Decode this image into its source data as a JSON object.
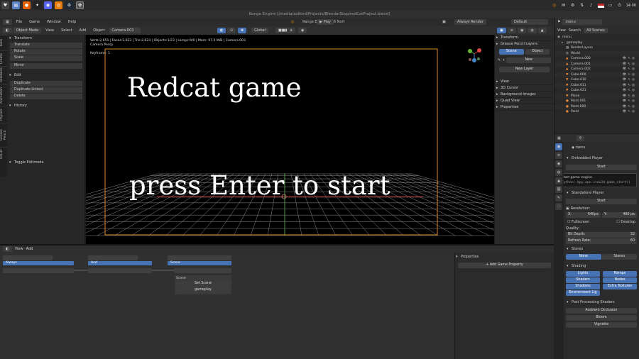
{
  "window": {
    "title": "Range Engine [/media/solford/Projects/BlenderStop/redCatProject.blend]",
    "version": "Range Engine v1.6 Nort"
  },
  "taskbar": {
    "time": "14:00",
    "apps": [
      "heart-icon",
      "file-manager-icon",
      "firefox-icon",
      "inkscape-icon",
      "discord-icon",
      "blender-icon",
      "steam-icon",
      "range-engine-icon"
    ]
  },
  "menu": {
    "items": [
      "File",
      "Game",
      "Window",
      "Help"
    ],
    "workspace": "Default",
    "scene": "menu",
    "play_label": "Play",
    "renderer": "Always Render"
  },
  "viewport_header": {
    "mode": "Object Mode",
    "items": [
      "View",
      "Select",
      "Add",
      "Object"
    ],
    "camera": "Camera.003",
    "pivot": "Global"
  },
  "toolshelf": {
    "tabs": [
      "Tools",
      "Create",
      "Relations",
      "Animation",
      "Physics",
      "Grease Pencil",
      "ReCat"
    ],
    "transform_title": "Transform",
    "transform_buttons": [
      "Translate",
      "Rotate",
      "Scale",
      "Mirror"
    ],
    "edit_title": "Edit",
    "edit_buttons": [
      "Duplicate",
      "Duplicate Linked",
      "Delete"
    ],
    "history_title": "History",
    "toggle_label": "Toggle Editmode"
  },
  "viewport": {
    "stats": "Verts:2,651 | Faces:2,623 | Tris:2,623 | Objects:1/23 | Lamps:9/0 | Mem: 97.0 MiB | Camera.003",
    "view_name": "Camera Persp",
    "keyframe_label": "Keyframe: 1",
    "title_text": "Redcat game",
    "prompt_text": "press Enter to start"
  },
  "npanel": {
    "transform": "Transform",
    "grease_pencil": "Grease Pencil Layers",
    "scene_btn": "Scene",
    "object_btn": "Object",
    "new_btn": "New",
    "new_layer_btn": "New Layer",
    "sections": [
      "View",
      "3D Cursor",
      "Background Images",
      "Quad View",
      "Properties"
    ]
  },
  "outliner": {
    "header_items": [
      "View",
      "Search",
      "All Scenes"
    ],
    "search_value": "menu",
    "rows": [
      "menu",
      "gameplay",
      "RenderLayers",
      "World",
      "Camera.000",
      "Camera.001",
      "Camera.002",
      "Cube.000",
      "Cube.010",
      "Cube.011",
      "Cube.021",
      "Plane",
      "Point.001",
      "Point.000",
      "Point"
    ]
  },
  "properties": {
    "object_name": "menu",
    "embedded_player": "Embedded Player",
    "start_btn": "Start",
    "tooltip_title": "Start game engine.",
    "tooltip_python": "Python: bpy.ops.view3d.game_start()",
    "standalone_player": "Standalone Player",
    "start_btn2": "Start",
    "resolution_label": "Resolution:",
    "res_x": "640px",
    "res_y": "480 px",
    "x_label": "X:",
    "y_label": "Y:",
    "fullscreen": "Fullscreen",
    "desktop": "Desktop",
    "quality": "Quality:",
    "bit_depth": "Bit Depth:",
    "refresh": "Refresh Rate:",
    "bit_depth_val": "32",
    "refresh_val": "60",
    "stereo": "Stereo",
    "stereo_none": "None",
    "stereo_stereo": "Stereo",
    "shading": "Shading",
    "shading_buttons": [
      "Lights",
      "Ramps",
      "Shaders",
      "Nodes",
      "Shadows",
      "Extra Textures",
      "Environment Lig"
    ],
    "post_processing": "Post Processing Shaders",
    "pp_items": [
      "Ambient Occlusion",
      "Bloom",
      "Vignette"
    ]
  },
  "logic": {
    "header_items": [
      "View",
      "Add"
    ],
    "sensor_name": "Always",
    "controller_name": "And",
    "actuator_name": "Scene",
    "scene_label": "Scene",
    "mode_label": "Set Scene",
    "target_label": "gameplay",
    "props_title": "Properties",
    "add_prop_btn": "Add Game Property"
  },
  "colors": {
    "accent": "#4772b3",
    "frame": "#e0892a",
    "grid": "#8a8a8a"
  }
}
